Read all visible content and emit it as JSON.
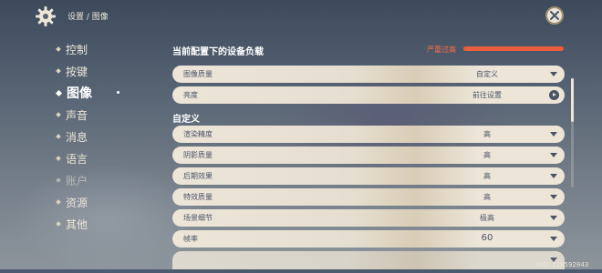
{
  "breadcrumb": "设置 / 图像",
  "nav": {
    "items": [
      {
        "label": "控制",
        "state": "normal"
      },
      {
        "label": "按键",
        "state": "normal"
      },
      {
        "label": "图像",
        "state": "active"
      },
      {
        "label": "声音",
        "state": "normal"
      },
      {
        "label": "消息",
        "state": "normal"
      },
      {
        "label": "语言",
        "state": "normal"
      },
      {
        "label": "账户",
        "state": "dim"
      },
      {
        "label": "资源",
        "state": "normal"
      },
      {
        "label": "其他",
        "state": "normal"
      }
    ]
  },
  "load": {
    "title": "当前配置下的设备负载",
    "level_text": "严重过高",
    "color": "#e85d3c"
  },
  "rows_top": [
    {
      "label": "图像质量",
      "value": "自定义",
      "control": "dropdown"
    },
    {
      "label": "亮度",
      "value": "前往设置",
      "control": "go"
    }
  ],
  "custom_title": "自定义",
  "rows_custom": [
    {
      "label": "渲染精度",
      "value": "高",
      "control": "dropdown"
    },
    {
      "label": "阴影质量",
      "value": "高",
      "control": "dropdown"
    },
    {
      "label": "后期效果",
      "value": "高",
      "control": "dropdown"
    },
    {
      "label": "特效质量",
      "value": "高",
      "control": "dropdown"
    },
    {
      "label": "场景细节",
      "value": "极高",
      "control": "dropdown"
    },
    {
      "label": "帧率",
      "value": "60",
      "control": "dropdown"
    }
  ],
  "uid": "UID: 138592843",
  "colors": {
    "panel": "#ece5d8",
    "text_dark": "#4b5366",
    "warning": "#ff6b4a"
  },
  "icons": {
    "settings": "gear-icon",
    "close": "close-icon",
    "dropdown": "caret-down-icon",
    "go": "arrow-right-icon"
  }
}
